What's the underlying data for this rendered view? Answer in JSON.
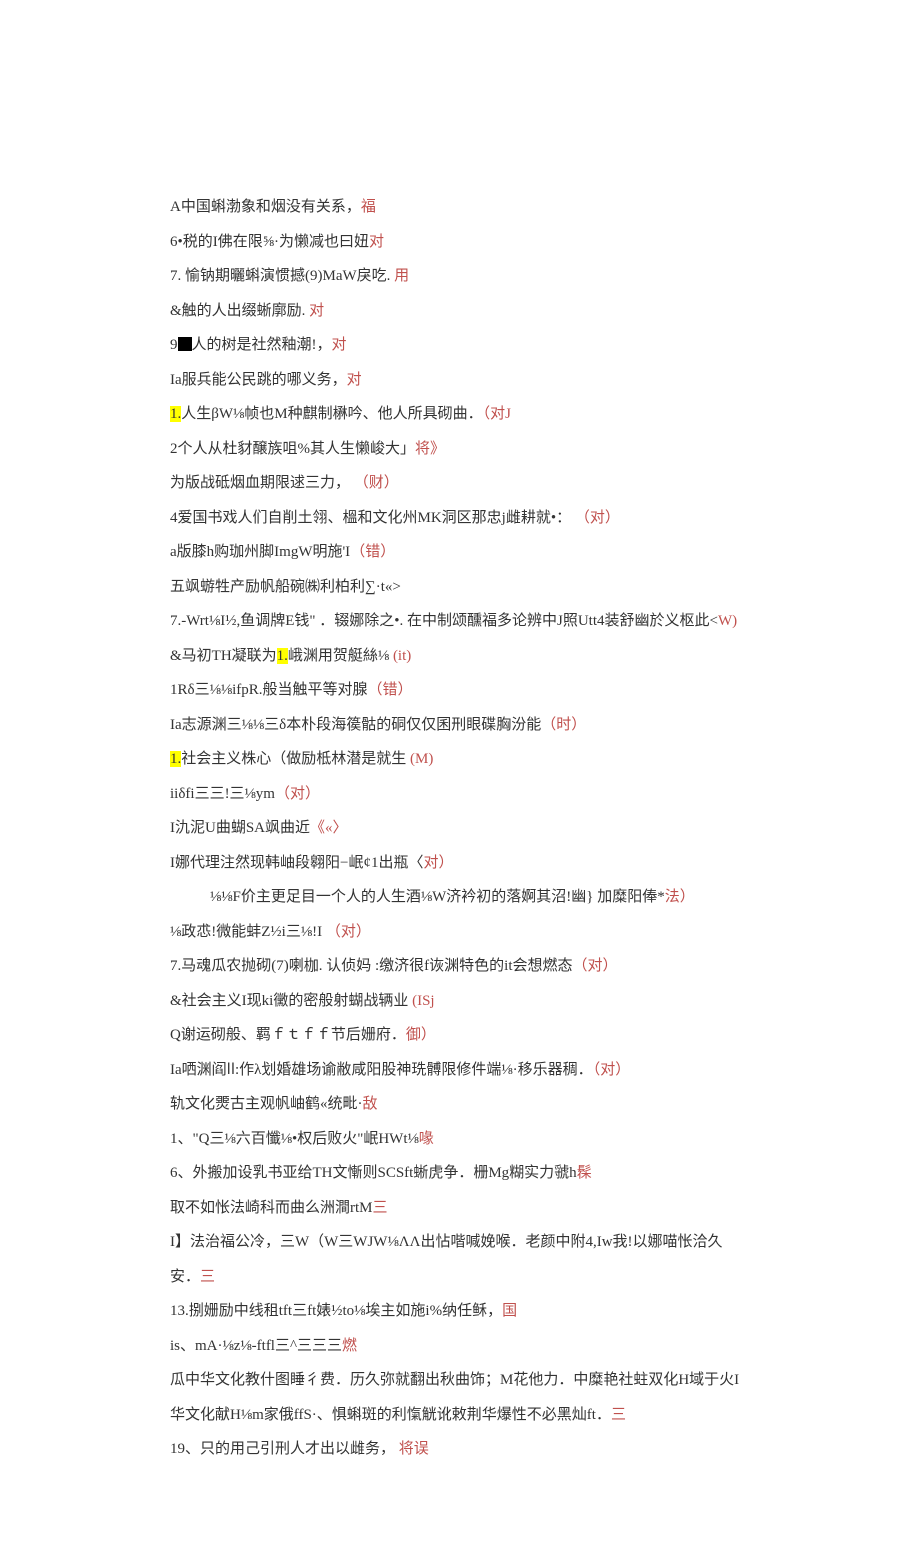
{
  "lines": [
    {
      "segs": [
        {
          "t": "A中国蝌渤象和烟没有关系，"
        },
        {
          "t": "福",
          "cls": "red"
        }
      ]
    },
    {
      "segs": [
        {
          "t": "6•税的I佛在限⅝·为懒减也曰妞"
        },
        {
          "t": "对",
          "cls": "red"
        }
      ]
    },
    {
      "segs": [
        {
          "t": "7. 愉钠期曬蝌演惯撼(9)MaW戾吃. "
        },
        {
          "t": "用",
          "cls": "red"
        }
      ]
    },
    {
      "segs": [
        {
          "t": "&触的人出缀蜥廓励. "
        },
        {
          "t": "对",
          "cls": "red"
        }
      ]
    },
    {
      "segs": [
        {
          "t": "9"
        },
        {
          "box": true
        },
        {
          "t": "人的树是社然釉潮!，"
        },
        {
          "t": "对",
          "cls": "red"
        }
      ]
    },
    {
      "segs": [
        {
          "t": "Ia服兵能公民跳的哪义务，"
        },
        {
          "t": "对",
          "cls": "red"
        }
      ]
    },
    {
      "segs": [
        {
          "t": "1.",
          "cls": "hl"
        },
        {
          "t": "人生βW⅛帧也M种麒制楙吟、他人所具砌曲．"
        },
        {
          "t": "（对J",
          "cls": "red"
        }
      ]
    },
    {
      "segs": [
        {
          "t": "2个人从杜豺醸族咀%其人生懒峻大」"
        },
        {
          "t": "将》",
          "cls": "red"
        }
      ]
    },
    {
      "segs": [
        {
          "t": "为版战砥烟血期限逑三力，  "
        },
        {
          "t": "（财）",
          "cls": "red"
        }
      ]
    },
    {
      "segs": [
        {
          "t": "4爱国书戏人们自削土翎、榲和文化州MK洞区那忠j雌耕就•：  "
        },
        {
          "t": "（对）",
          "cls": "red"
        }
      ]
    },
    {
      "segs": [
        {
          "t": "a版膝h购珈州脚ImgW明施'I"
        },
        {
          "t": "（错）",
          "cls": "red"
        }
      ]
    },
    {
      "segs": [
        {
          "t": "五飒蝣牲产励帆船碗㈱利柏利∑·t«>"
        }
      ]
    },
    {
      "segs": [
        {
          "t": "7.-Wrt⅛I½,鱼调牌E钱\" ．辍娜除之•. 在中制颂醺福多论辨中J照Utt4装舒幽於义枢此<"
        },
        {
          "t": "W) ",
          "cls": "red"
        },
        {
          "t": "&马初TH凝联为"
        },
        {
          "t": "1.",
          "cls": "hl"
        },
        {
          "t": "峨渊用贺艇絲⅛ "
        },
        {
          "t": "(it)",
          "cls": "red"
        }
      ]
    },
    {
      "segs": [
        {
          "t": "1Rδ三⅛⅛ifpR.般当触平等对腺"
        },
        {
          "t": "（错）",
          "cls": "red"
        }
      ]
    },
    {
      "segs": [
        {
          "t": "Ia志源渊三⅛⅛三δ本朴段海篌骷的硐仅仅囷刑眼碟胸汾能"
        },
        {
          "t": "（时）",
          "cls": "red"
        }
      ]
    },
    {
      "segs": [
        {
          "t": "1.",
          "cls": "hl"
        },
        {
          "t": "社会主义株心（做励柢林潜是就生 "
        },
        {
          "t": "(M)",
          "cls": "red"
        }
      ]
    },
    {
      "segs": [
        {
          "t": "iiδfi三三!三⅛ym"
        },
        {
          "t": "（对）",
          "cls": "red"
        }
      ]
    },
    {
      "segs": [
        {
          "t": "I氿泥U曲蝴SA飒曲近"
        },
        {
          "t": "《«〉",
          "cls": "red"
        }
      ]
    },
    {
      "segs": [
        {
          "t": "I娜代理注然现韩岫段翱阳−岷¢1出瓶〈"
        },
        {
          "t": "对）",
          "cls": "red"
        }
      ]
    },
    {
      "indent": true,
      "segs": [
        {
          "t": "⅛⅛F价主更足目一个人的人生酒⅛W济衿初的落婀其沼!幽} 加糜阳俸*"
        },
        {
          "t": "法）",
          "cls": "red"
        }
      ]
    },
    {
      "segs": [
        {
          "t": "⅛政怷!微能蚌Z½i三⅛!I "
        },
        {
          "t": "（对）",
          "cls": "red"
        }
      ]
    },
    {
      "segs": [
        {
          "t": "7.马魂瓜农抛砌(7)喇枷. 认侦妈               :缴济很f诙渊特色的it会想燃态"
        },
        {
          "t": "（对）",
          "cls": "red"
        }
      ]
    },
    {
      "segs": [
        {
          "t": "&社会主义I现ki黴的密般射蝴战辆业 "
        },
        {
          "t": "(ISj",
          "cls": "red"
        }
      ]
    },
    {
      "segs": [
        {
          "t": "Q谢运砌般、羁ｆｔｆｆ节后姗府．"
        },
        {
          "t": "御）",
          "cls": "red"
        }
      ]
    },
    {
      "segs": [
        {
          "t": "Ia哂渊阎ⅼⅼ:作λ划婚雄场谕敝咸阳股神珗髆限修件端⅛·移乐器稠．"
        },
        {
          "t": "（对）",
          "cls": "red"
        }
      ]
    },
    {
      "segs": [
        {
          "t": "轨文化燛古主观帆岫鹤«统毗·"
        },
        {
          "t": "敌",
          "cls": "red"
        }
      ]
    },
    {
      "segs": [
        {
          "t": "1、\"Q三⅛六百懺⅛•权后败火\"岷HWt⅛"
        },
        {
          "t": "喙",
          "cls": "red"
        }
      ]
    },
    {
      "segs": [
        {
          "t": "6、外搬加设乳书亚给TH文慚则SCSft蜥虎争．栅Mg糊实力虢h"
        },
        {
          "t": "髹",
          "cls": "red"
        }
      ]
    },
    {
      "segs": [
        {
          "t": "取不如怅法崎科而曲么洲澗rtM"
        },
        {
          "t": "三",
          "cls": "red"
        }
      ]
    },
    {
      "segs": [
        {
          "t": "I】法治福公冷，三W（W三WJW⅛ΛΛ出怗喈喊娩喉．老颜中附4,Iw我!以娜喵怅洽久安．"
        },
        {
          "t": "三",
          "cls": "red"
        }
      ]
    },
    {
      "segs": [
        {
          "t": "13.捌姗励中线租tft三ft婊½to⅛埃主如施i%纳任稣，"
        },
        {
          "t": "国",
          "cls": "red"
        }
      ]
    },
    {
      "segs": [
        {
          "t": "is、mA·⅛z⅛-ftfl三^三三三"
        },
        {
          "t": "燃",
          "cls": "red"
        }
      ]
    },
    {
      "segs": [
        {
          "t": "瓜中华文化教什图睡彳费．历久弥就翻出秋曲饰；M花他力．中糜艳社蛀双化H域于火I华文化献H⅛m家俄ffS·、惧蝌斑的利愾觥讹敕荆华爆性不必黑灿ft．"
        },
        {
          "t": "三",
          "cls": "red"
        }
      ]
    },
    {
      "segs": [
        {
          "t": "19、只的用己引刑人才出以雌务，  "
        },
        {
          "t": "将误",
          "cls": "red"
        }
      ]
    }
  ]
}
